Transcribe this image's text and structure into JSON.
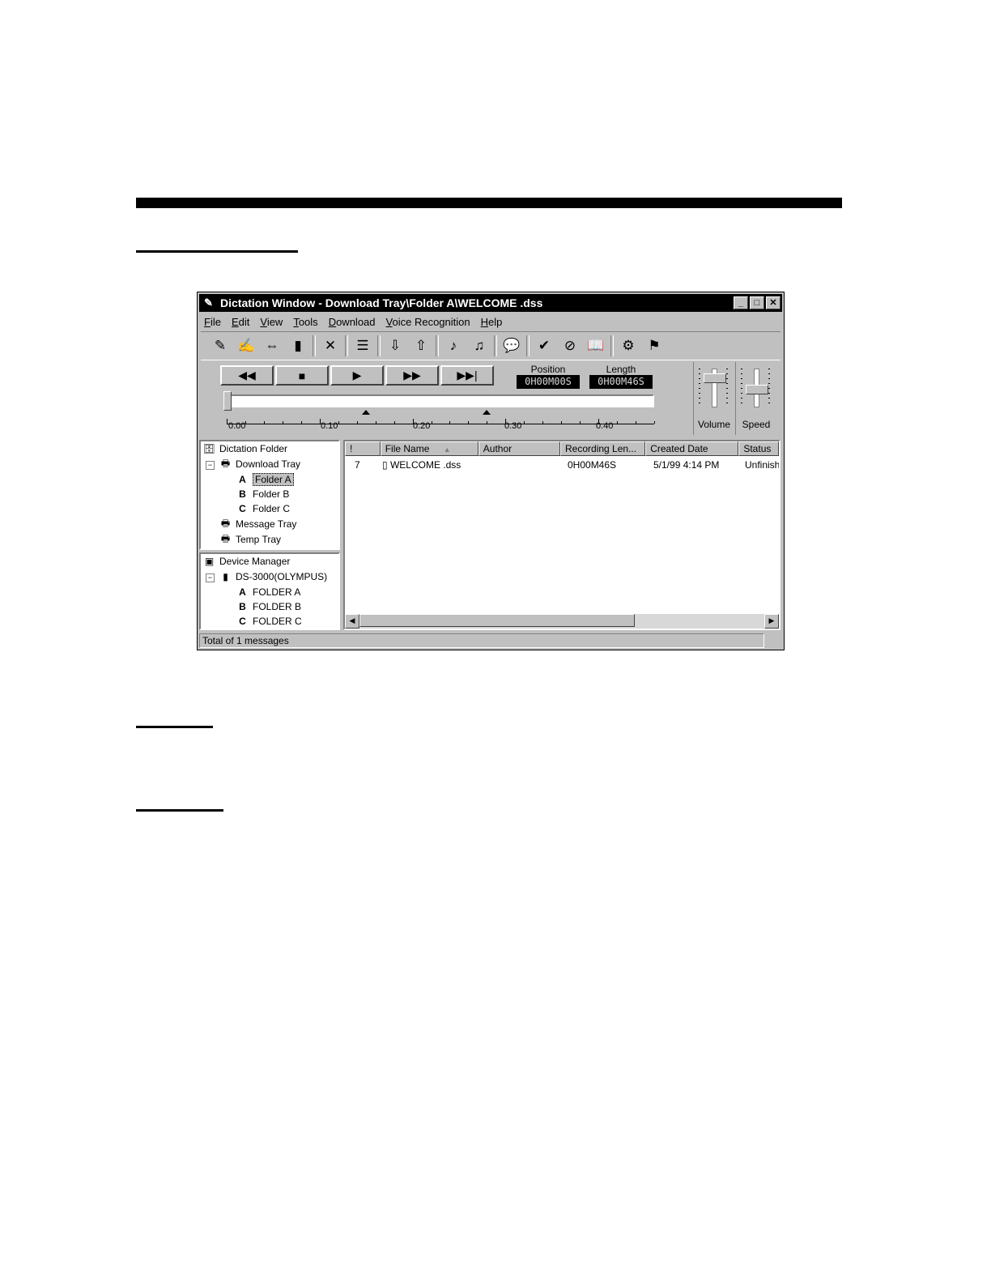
{
  "window": {
    "title": "Dictation Window - Download Tray\\Folder A\\WELCOME .dss",
    "controls": {
      "minimize": "_",
      "maximize": "□",
      "close": "✕"
    }
  },
  "menu": [
    "File",
    "Edit",
    "View",
    "Tools",
    "Download",
    "Voice Recognition",
    "Help"
  ],
  "toolbar": {
    "icons": [
      "record-pen-icon",
      "edit-pen-icon",
      "insert-icon",
      "device-icon",
      "delete-icon",
      "properties-icon",
      "download-icon",
      "upload-icon",
      "voice-in-icon",
      "voice-out-icon",
      "comment-icon",
      "check-icon",
      "verify-icon",
      "dictionary-icon",
      "train-icon",
      "enroll-icon"
    ],
    "delete_glyph": "✕",
    "check_glyph": "✔"
  },
  "transport": {
    "buttons": [
      {
        "name": "rewind-button",
        "glyph": "◀◀"
      },
      {
        "name": "stop-button",
        "glyph": "■"
      },
      {
        "name": "play-button",
        "glyph": "▶"
      },
      {
        "name": "fast-forward-button",
        "glyph": "▶▶"
      },
      {
        "name": "skip-end-button",
        "glyph": "▶▶|"
      }
    ],
    "position_label": "Position",
    "position_value": "0H00M00S",
    "length_label": "Length",
    "length_value": "0H00M46S",
    "ruler_labels": [
      "0.00",
      "0.10",
      "0.20",
      "0.30",
      "0.40"
    ],
    "markers_at": [
      0.15,
      0.28
    ],
    "playhead_at": 0.0
  },
  "sliders": {
    "volume_label": "Volume",
    "speed_label": "Speed",
    "volume_level": 0.85,
    "speed_level": 0.5
  },
  "dictation_tree": {
    "root": "Dictation Folder",
    "download_tray": "Download Tray",
    "folders": [
      {
        "letter": "A",
        "label": "Folder A"
      },
      {
        "letter": "B",
        "label": "Folder B"
      },
      {
        "letter": "C",
        "label": "Folder C"
      }
    ],
    "message_tray": "Message Tray",
    "temp_tray": "Temp Tray",
    "expander": "⊟"
  },
  "device_tree": {
    "root": "Device Manager",
    "device": "DS-3000(OLYMPUS)",
    "folders": [
      {
        "letter": "A",
        "label": "FOLDER A"
      },
      {
        "letter": "B",
        "label": "FOLDER B"
      },
      {
        "letter": "C",
        "label": "FOLDER C"
      }
    ]
  },
  "file_list": {
    "columns": [
      "!",
      "File Name",
      "Author",
      "Recording Len...",
      "Created Date",
      "Status"
    ],
    "sort_indicator": "▲",
    "rows": [
      {
        "priority": "7",
        "file_name": "WELCOME .dss",
        "author": "",
        "length": "0H00M46S",
        "created": "5/1/99 4:14 PM",
        "status": "Unfinish"
      }
    ]
  },
  "status_bar": {
    "text": "Total of 1 messages"
  }
}
